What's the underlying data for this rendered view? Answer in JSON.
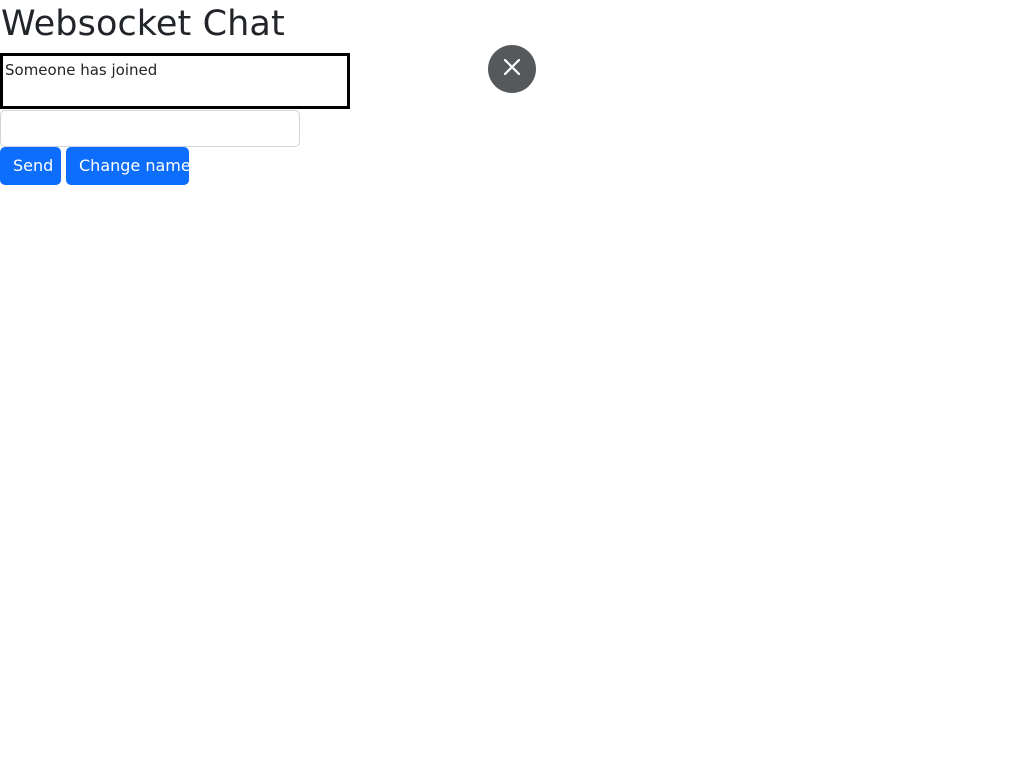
{
  "page": {
    "title": "Websocket Chat"
  },
  "messages": {
    "items": [
      "Someone has joined"
    ]
  },
  "message_input": {
    "value": "",
    "placeholder": ""
  },
  "buttons": {
    "send_label": "Send",
    "change_name_label": "Change name"
  },
  "icons": {
    "close": "close-icon"
  },
  "colors": {
    "primary": "#0d6efd",
    "close_button": "#55595c",
    "messages_border": "#000000"
  }
}
